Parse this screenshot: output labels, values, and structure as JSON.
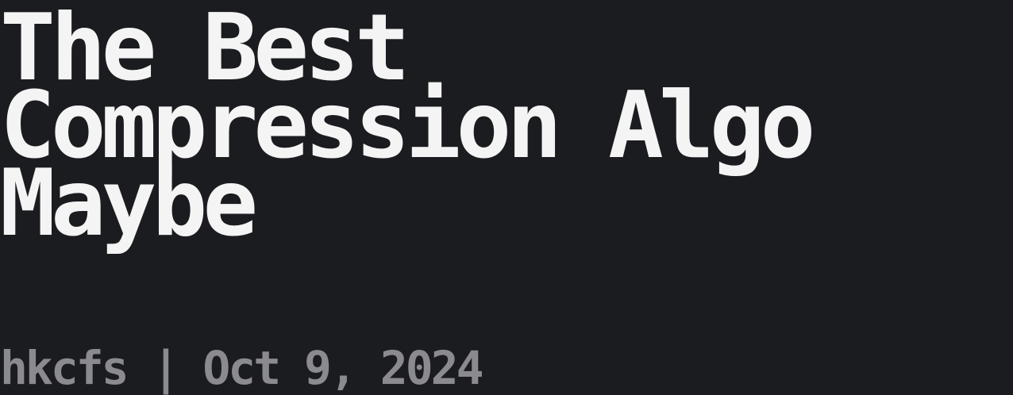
{
  "post": {
    "title_lines": [
      "The Best",
      "Compression Algo",
      "Maybe"
    ],
    "author": "hkcfs",
    "separator": "|",
    "date": "Oct 9, 2024"
  },
  "colors": {
    "background": "#1b1c20",
    "title": "#f4f4f4",
    "meta": "#8b8b8f"
  }
}
